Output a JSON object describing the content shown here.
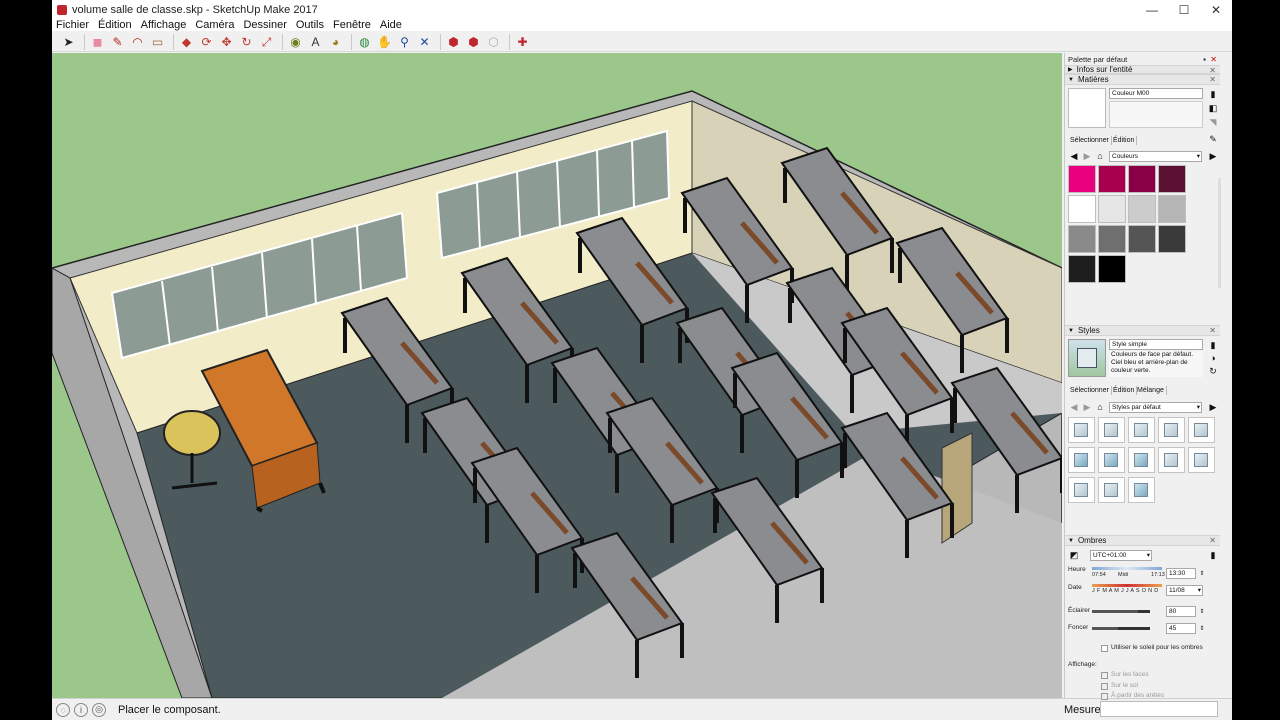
{
  "window": {
    "title": "volume salle de classe.skp - SketchUp Make 2017",
    "controls": [
      "—",
      "☐",
      "✕"
    ]
  },
  "menu": [
    "Fichier",
    "Édition",
    "Affichage",
    "Caméra",
    "Dessiner",
    "Outils",
    "Fenêtre",
    "Aide"
  ],
  "toolbar": {
    "tools": [
      {
        "name": "select-tool-icon",
        "glyph": "➤",
        "color": "#222"
      },
      {
        "name": "eraser-tool-icon",
        "glyph": "◼",
        "color": "#e88aa3"
      },
      {
        "name": "pencil-tool-icon",
        "glyph": "✎",
        "color": "#b5251b"
      },
      {
        "name": "arc-tool-icon",
        "glyph": "◠",
        "color": "#b5251b"
      },
      {
        "name": "rectangle-tool-icon",
        "glyph": "▭",
        "color": "#9a6b3a"
      },
      {
        "name": "push-pull-tool-icon",
        "glyph": "◆",
        "color": "#c0392b"
      },
      {
        "name": "follow-me-tool-icon",
        "glyph": "⟳",
        "color": "#c0392b"
      },
      {
        "name": "move-tool-icon",
        "glyph": "✥",
        "color": "#c0392b"
      },
      {
        "name": "rotate-tool-icon",
        "glyph": "↻",
        "color": "#c0392b"
      },
      {
        "name": "scale-tool-icon",
        "glyph": "⤢",
        "color": "#c0392b"
      },
      {
        "name": "tape-measure-icon",
        "glyph": "◉",
        "color": "#6b7f1c"
      },
      {
        "name": "text-tool-icon",
        "glyph": "A",
        "color": "#333"
      },
      {
        "name": "paint-bucket-icon",
        "glyph": "◕",
        "color": "#9a7a1c"
      },
      {
        "name": "orbit-tool-icon",
        "glyph": "◍",
        "color": "#2a8a3a"
      },
      {
        "name": "pan-tool-icon",
        "glyph": "✋",
        "color": "#c8961c"
      },
      {
        "name": "zoom-tool-icon",
        "glyph": "⚲",
        "color": "#1c4a9a"
      },
      {
        "name": "zoom-extents-icon",
        "glyph": "✕",
        "color": "#1c4a9a"
      },
      {
        "name": "warehouse-icon",
        "glyph": "⬢",
        "color": "#c0262d"
      },
      {
        "name": "share-model-icon",
        "glyph": "⬢",
        "color": "#c0262d"
      },
      {
        "name": "extension-icon",
        "glyph": "⬡",
        "color": "#aaa"
      },
      {
        "name": "extension-warehouse-icon",
        "glyph": "✚",
        "color": "#c0262d"
      }
    ]
  },
  "status": {
    "message": "Placer le composant.",
    "measurements_label": "Mesures"
  },
  "tray": {
    "title": "Palette par défaut",
    "entity_info": "Infos sur l'entité",
    "materials": {
      "header": "Matières",
      "material_name": "Couleur M00",
      "tab_select": "Sélectionner",
      "tab_edit": "Édition",
      "library": "Couleurs",
      "swatches": [
        [
          "#e8007e",
          "#a8004f",
          "#8a0046",
          "#5a1030"
        ],
        [
          "#ffffff",
          "#e6e6e6",
          "#cccccc",
          "#b5b5b5"
        ],
        [
          "#8a8a8a",
          "#6f6f6f",
          "#555555",
          "#3a3a3a"
        ],
        [
          "#1e1e1e",
          "#000000"
        ]
      ]
    },
    "styles": {
      "header": "Styles",
      "style_name": "Style simple",
      "style_desc": "Couleurs de face par défaut. Ciel bleu et arrière-plan de couleur verte.",
      "tab_select": "Sélectionner",
      "tab_edit": "Édition",
      "tab_mix": "Mélange",
      "library": "Styles par défaut",
      "thumb_count": 13
    },
    "shadows": {
      "header": "Ombres",
      "timezone": "UTC+01:00",
      "time_label": "Heure",
      "time_start": "07:54",
      "time_mid": "Midi",
      "time_end": "17:13",
      "time_value": "13:30",
      "date_label": "Date",
      "months": "J F M A M J J A S O N D",
      "date_value": "11/08",
      "light_label": "Éclairer",
      "light_value": "80",
      "light_level": 0.8,
      "dark_label": "Foncer",
      "dark_value": "45",
      "dark_level": 0.45,
      "use_sun": "Utiliser le soleil pour les ombres",
      "display_label": "Affichage:",
      "on_faces": "Sur les faces",
      "on_ground": "Sur le sol",
      "from_edges": "À partir des arêtes"
    }
  },
  "scene": {
    "sky_color": "#9cc78b",
    "floor_color": "#4c5a5e",
    "wall_color": "#f3ecc9",
    "desk_color": "#8a8c8f"
  }
}
